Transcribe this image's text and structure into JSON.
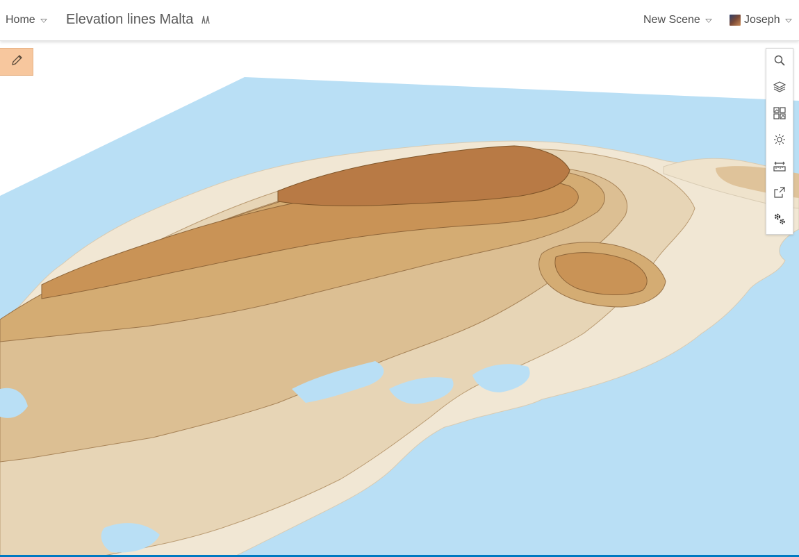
{
  "header": {
    "home_label": "Home",
    "title": "Elevation lines Malta",
    "new_scene_label": "New Scene",
    "user_name": "Joseph"
  },
  "colors": {
    "water": "#b9dff5",
    "land_low": "#f1e7d4",
    "land_high": "#b87a45",
    "edit_button": "#f7c79e",
    "accent": "#0079c1"
  },
  "map_tools": [
    {
      "name": "search-icon"
    },
    {
      "name": "layers-icon"
    },
    {
      "name": "basemap-gallery-icon"
    },
    {
      "name": "daylight-icon"
    },
    {
      "name": "measure-icon"
    },
    {
      "name": "share-icon"
    },
    {
      "name": "settings-icon"
    }
  ]
}
